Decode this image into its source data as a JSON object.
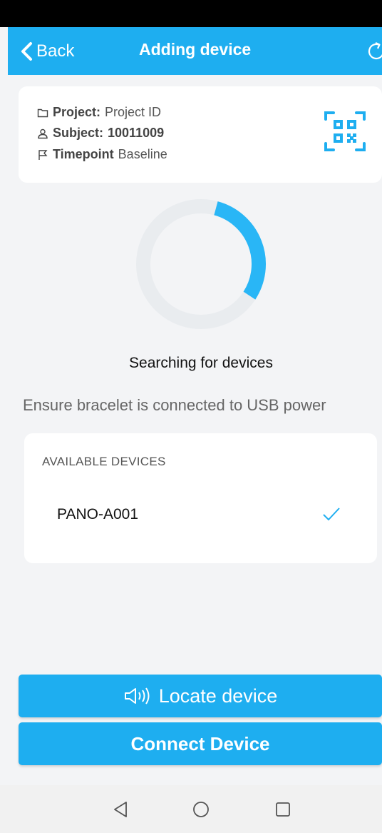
{
  "header": {
    "back_label": "Back",
    "title": "Adding device",
    "refresh_icon": "refresh-icon"
  },
  "info": {
    "project_label": "Project:",
    "project_value": "Project ID",
    "subject_label": "Subject:",
    "subject_value": "10011009",
    "timepoint_label": "Timepoint",
    "timepoint_value": "Baseline",
    "qr_icon": "qr-scan-icon"
  },
  "search": {
    "status": "Searching for devices",
    "hint": "Ensure bracelet is connected to USB power",
    "progress_fraction": 0.3
  },
  "devices": {
    "header": "AVAILABLE DEVICES",
    "items": [
      {
        "name": "PANO-A001",
        "selected": true
      }
    ]
  },
  "actions": {
    "locate_label": "Locate device",
    "connect_label": "Connect Device"
  },
  "colors": {
    "accent": "#1eaef0",
    "background": "#f3f4f6"
  }
}
